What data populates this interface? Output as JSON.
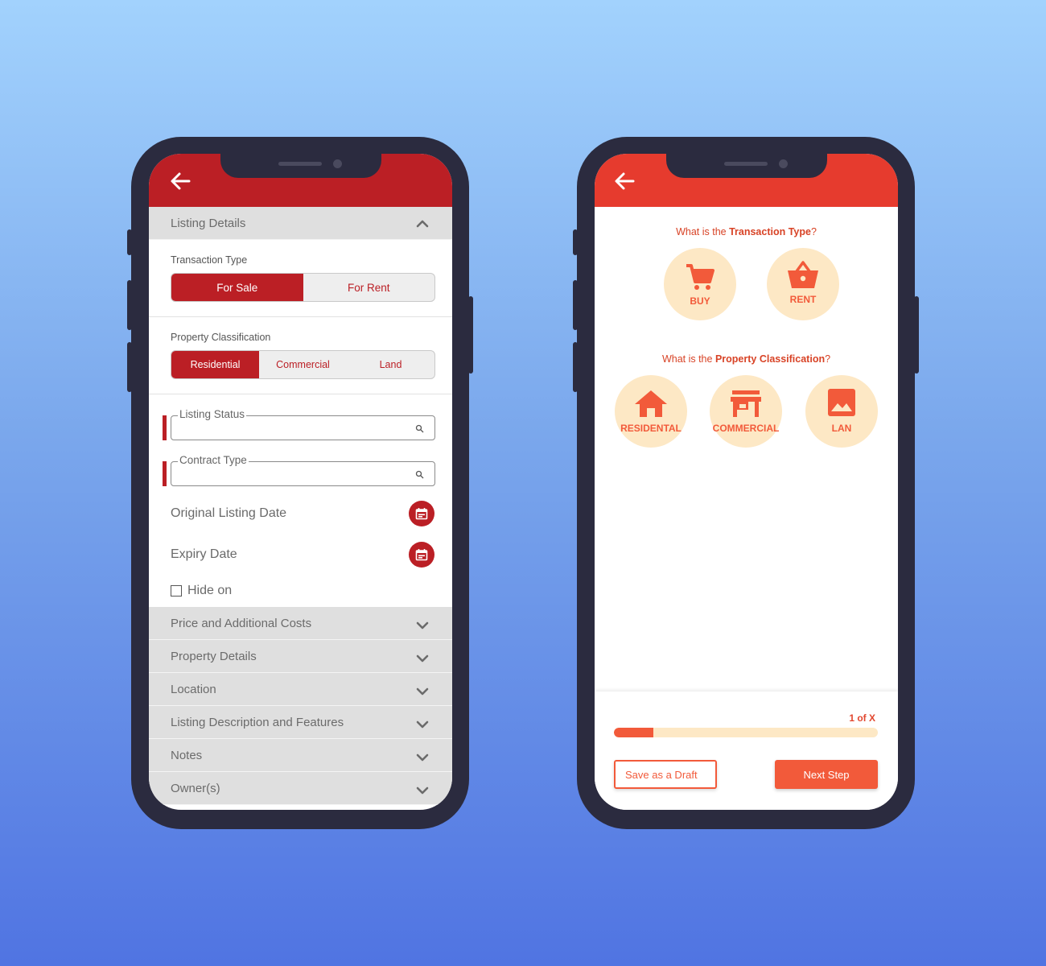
{
  "left_screen": {
    "listing_details_header": "Listing Details",
    "transaction_type": {
      "label": "Transaction Type",
      "options": [
        "For Sale",
        "For Rent"
      ],
      "selected": "For Sale"
    },
    "property_classification": {
      "label": "Property Classification",
      "options": [
        "Residential",
        "Commercial",
        "Land"
      ],
      "selected": "Residential"
    },
    "listing_status_label": "Listing Status",
    "contract_type_label": "Contract Type",
    "original_listing_date_label": "Original Listing Date",
    "expiry_date_label": "Expiry Date",
    "hide_on_label": "Hide on",
    "collapsed_sections": [
      "Price and Additional Costs",
      "Property Details",
      "Location",
      "Listing Description and Features",
      "Notes",
      "Owner(s)"
    ]
  },
  "right_screen": {
    "q1": {
      "prefix": "What is the ",
      "bold": "Transaction Type",
      "suffix": "?"
    },
    "transaction_options": [
      {
        "label": "BUY",
        "icon": "cart-icon"
      },
      {
        "label": "RENT",
        "icon": "basket-icon"
      }
    ],
    "q2": {
      "prefix": "What is the ",
      "bold": "Property Classification",
      "suffix": "?"
    },
    "classification_options": [
      {
        "label": "RESIDENTAL",
        "icon": "house-icon"
      },
      {
        "label": "COMMERCIAL",
        "icon": "store-icon"
      },
      {
        "label": "LAN",
        "icon": "image-icon"
      }
    ],
    "progress": {
      "label": "1 of X",
      "fraction": 0.15
    },
    "save_draft_label": "Save as a Draft",
    "next_step_label": "Next Step"
  },
  "colors": {
    "left_accent": "#bb1f25",
    "right_accent": "#f25a3a",
    "right_header": "#e63b2e",
    "circle_bg": "#fde8c5"
  }
}
